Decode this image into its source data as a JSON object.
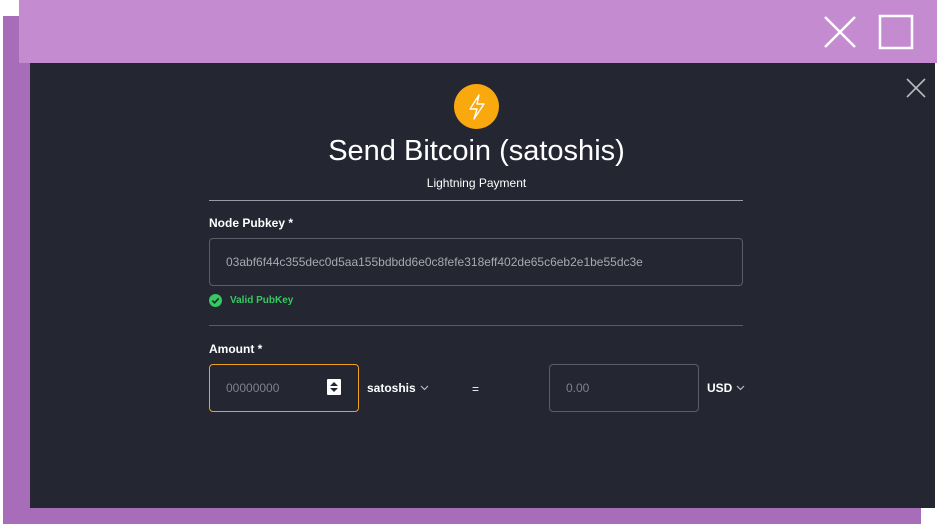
{
  "window": {
    "close_icon": "close-icon",
    "maximize_icon": "maximize-icon"
  },
  "colors": {
    "accent": "#f9a80d",
    "dialog_bg": "#242631",
    "valid_green": "#35c961",
    "focus_border": "#f0a020",
    "titlebar": "#c58bd1"
  },
  "dialog": {
    "icon": "lightning-icon",
    "title": "Send Bitcoin (satoshis)",
    "subtitle": "Lightning Payment"
  },
  "pubkey": {
    "label": "Node Pubkey *",
    "value": "03abf6f44c355dec0d5aa155bdbdd6e0c8fefe318eff402de65c6eb2e1be55dc3e",
    "validation": "Valid PubKey"
  },
  "amount": {
    "label": "Amount *",
    "placeholder": "00000000",
    "unit": "satoshis",
    "equals": "=",
    "fiat_placeholder": "0.00",
    "fiat_currency": "USD"
  }
}
